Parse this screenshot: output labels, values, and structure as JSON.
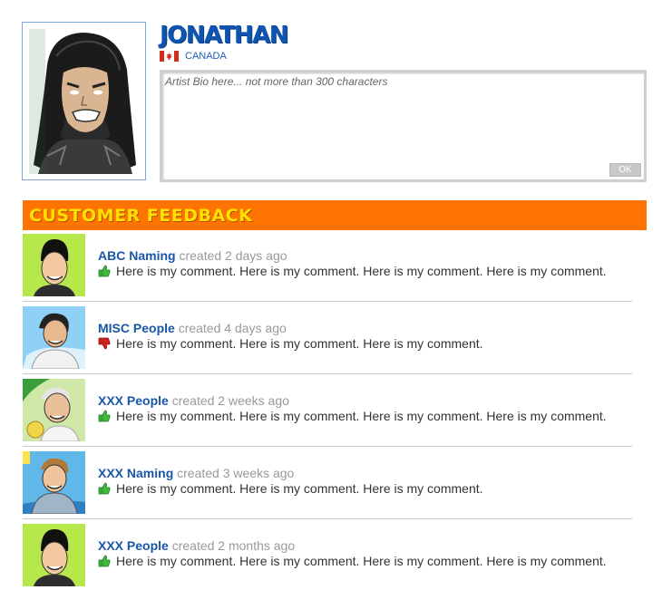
{
  "profile": {
    "name": "JONATHAN",
    "country": "CANADA",
    "bio_placeholder": "Artist Bio here... not more than 300 characters",
    "ok_label": "OK",
    "flag_icon": "canada-flag-icon"
  },
  "feedback": {
    "title": "CUSTOMER FEEDBACK",
    "items": [
      {
        "author": "ABC Naming",
        "created": "created 2 days ago",
        "vote": "thumbs-up",
        "comment": "Here is my comment. Here is my comment. Here is my comment. Here is my comment.",
        "thumb_bg": "#b6e84c"
      },
      {
        "author": "MISC People",
        "created": "created 4 days ago",
        "vote": "thumbs-down",
        "comment": "Here is my comment. Here is my comment. Here is my comment.",
        "thumb_bg": "#8fd0f5"
      },
      {
        "author": "XXX People",
        "created": "created 2 weeks ago",
        "vote": "thumbs-up",
        "comment": "Here is my comment. Here is my comment. Here is my comment. Here is my comment.",
        "thumb_bg": "#cfe8a8"
      },
      {
        "author": "XXX Naming",
        "created": "created 3 weeks ago",
        "vote": "thumbs-up",
        "comment": "Here is my comment. Here is my comment. Here is my comment.",
        "thumb_bg": "#5fb8e8"
      },
      {
        "author": "XXX People",
        "created": "created 2 months ago",
        "vote": "thumbs-up",
        "comment": "Here is my comment. Here is my comment. Here is my comment. Here is my comment.",
        "thumb_bg": "#b6e84c"
      }
    ]
  },
  "colors": {
    "accent_orange": "#ff7300",
    "title_yellow": "#ffe000",
    "link_blue": "#1a56a8",
    "thumbs_up": "#3dbb3d",
    "thumbs_down": "#d62020"
  }
}
